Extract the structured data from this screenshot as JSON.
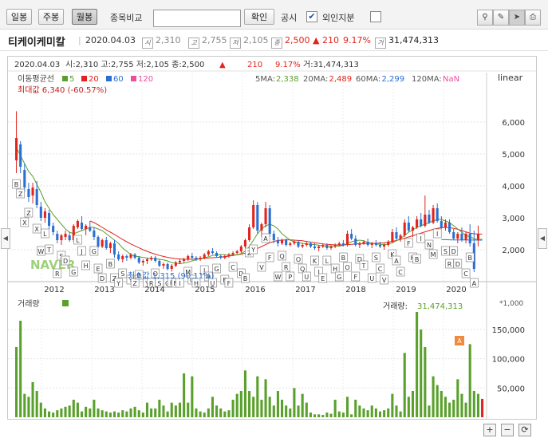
{
  "toolbar": {
    "daily": "일봉",
    "weekly": "주봉",
    "monthly": "월봉",
    "compare_label": "종목비교",
    "compare_value": "",
    "confirm": "확인",
    "disclosure": "공시",
    "disclosure_mark": "✔",
    "foreign": "외인지분"
  },
  "stock": {
    "name": "티케이케미칼",
    "date": "2020.04.03",
    "open_badge": "시",
    "open": "2,310",
    "high_badge": "고",
    "high": "2,755",
    "low_badge": "저",
    "low": "2,105",
    "close_badge": "종",
    "close": "2,500",
    "change": "▲ 210",
    "change_pct": "9.17%",
    "volume_badge": "거",
    "volume": "31,474,313"
  },
  "chart_header": {
    "line1_date": "2020.04.03",
    "line1_ohlc": "시:2,310  고:2,755  저:2,105  종:2,500",
    "line1_arrow": "▲",
    "line1_change": "210",
    "line1_pct": "9.17%",
    "line1_vol": "거:31,474,313",
    "ma_title": "이동평균선",
    "ma_legend": [
      {
        "label": "5",
        "color": "#5aa02c"
      },
      {
        "label": "20",
        "color": "#e1241c"
      },
      {
        "label": "60",
        "color": "#2a6fd1"
      },
      {
        "label": "120",
        "color": "#ec4fa0"
      }
    ],
    "max_label": "최대값 6,340 (-60.57%)",
    "ma_values": [
      {
        "label": "5MA:",
        "value": "2,338",
        "color": "#5aa02c"
      },
      {
        "label": "20MA:",
        "value": "2,489",
        "color": "#e1241c"
      },
      {
        "label": "60MA:",
        "value": "2,299",
        "color": "#2a6fd1"
      },
      {
        "label": "120MA:",
        "value": "NaN",
        "color": "#ec4fa0"
      }
    ],
    "scale_mode": "linear",
    "min_label": "최소값 1,315 (90.11%)",
    "vol_title": "거래량",
    "vol_value_label": "거래량:",
    "vol_value": "31,474,313",
    "vol_unit": "*1,000",
    "watermark": "NAVER"
  },
  "chart_data": [
    {
      "type": "candlestick",
      "ylim": [
        1000,
        6800
      ],
      "yticks": [
        2000,
        3000,
        4000,
        5000,
        6000
      ],
      "ytick_labels": [
        "2,000",
        "3,000",
        "4,000",
        "5,000",
        "6,000"
      ],
      "xticks": [
        "2012",
        "2013",
        "2014",
        "2015",
        "2016",
        "2017",
        "2018",
        "2019",
        "2020"
      ],
      "ohlc": [
        [
          4800,
          6340,
          4400,
          5500
        ],
        [
          5300,
          5400,
          4400,
          4600
        ],
        [
          4500,
          4700,
          3800,
          3950
        ],
        [
          3900,
          4100,
          3500,
          3650
        ],
        [
          3700,
          4100,
          3450,
          3950
        ],
        [
          3900,
          4150,
          3300,
          3400
        ],
        [
          3350,
          3500,
          2900,
          3000
        ],
        [
          3000,
          3300,
          2850,
          3200
        ],
        [
          3150,
          3250,
          2650,
          2750
        ],
        [
          2750,
          2850,
          2450,
          2550
        ],
        [
          2500,
          2600,
          2200,
          2300
        ],
        [
          2300,
          2500,
          2150,
          2450
        ],
        [
          2400,
          2600,
          2300,
          2500
        ],
        [
          2450,
          2550,
          2250,
          2300
        ],
        [
          2300,
          2800,
          2250,
          2750
        ],
        [
          2700,
          2950,
          2650,
          2900
        ],
        [
          2850,
          3050,
          2600,
          2650
        ],
        [
          2650,
          2800,
          2450,
          2750
        ],
        [
          2700,
          2900,
          2550,
          2600
        ],
        [
          2600,
          2700,
          2300,
          2400
        ],
        [
          2400,
          2450,
          2050,
          2100
        ],
        [
          2100,
          2350,
          2050,
          2300
        ],
        [
          2300,
          2400,
          2000,
          2050
        ],
        [
          2050,
          2250,
          1900,
          2200
        ],
        [
          2200,
          2300,
          1750,
          1850
        ],
        [
          1850,
          1950,
          1650,
          1700
        ],
        [
          1700,
          1850,
          1600,
          1800
        ],
        [
          1800,
          1850,
          1650,
          1750
        ],
        [
          1750,
          1900,
          1700,
          1850
        ],
        [
          1850,
          1900,
          1700,
          1750
        ],
        [
          1750,
          1800,
          1550,
          1600
        ],
        [
          1600,
          1700,
          1500,
          1650
        ],
        [
          1650,
          1750,
          1550,
          1700
        ],
        [
          1700,
          1800,
          1650,
          1750
        ],
        [
          1750,
          1800,
          1600,
          1650
        ],
        [
          1650,
          1700,
          1450,
          1500
        ],
        [
          1500,
          1600,
          1400,
          1550
        ],
        [
          1550,
          1600,
          1350,
          1400
        ],
        [
          1400,
          1550,
          1315,
          1500
        ],
        [
          1500,
          1650,
          1450,
          1600
        ],
        [
          1600,
          1700,
          1550,
          1650
        ],
        [
          1650,
          1750,
          1600,
          1700
        ],
        [
          1700,
          1850,
          1650,
          1800
        ],
        [
          1800,
          1900,
          1700,
          1750
        ],
        [
          1750,
          1800,
          1650,
          1700
        ],
        [
          1700,
          1800,
          1650,
          1750
        ],
        [
          1750,
          1900,
          1700,
          1850
        ],
        [
          1850,
          2000,
          1800,
          1950
        ],
        [
          1950,
          2050,
          1850,
          1900
        ],
        [
          1900,
          1950,
          1750,
          1800
        ],
        [
          1800,
          1850,
          1700,
          1750
        ],
        [
          1750,
          1850,
          1700,
          1800
        ],
        [
          1800,
          1900,
          1750,
          1850
        ],
        [
          1850,
          1950,
          1800,
          1900
        ],
        [
          1900,
          2000,
          1850,
          1950
        ],
        [
          1950,
          2150,
          1900,
          2100
        ],
        [
          2100,
          2350,
          2050,
          2300
        ],
        [
          2300,
          2800,
          2250,
          2700
        ],
        [
          2700,
          3550,
          2650,
          3400
        ],
        [
          3400,
          3500,
          2500,
          2600
        ],
        [
          2600,
          2850,
          2400,
          2800
        ],
        [
          2800,
          3500,
          2700,
          3300
        ],
        [
          3300,
          3400,
          2400,
          2500
        ],
        [
          2500,
          2600,
          2200,
          2300
        ],
        [
          2300,
          2400,
          2100,
          2200
        ],
        [
          2200,
          2350,
          2150,
          2300
        ],
        [
          2300,
          2350,
          2100,
          2150
        ],
        [
          2150,
          2250,
          2100,
          2200
        ],
        [
          2200,
          2300,
          2150,
          2250
        ],
        [
          2250,
          2300,
          2050,
          2100
        ],
        [
          2100,
          2200,
          2050,
          2150
        ],
        [
          2150,
          2250,
          2100,
          2200
        ],
        [
          2200,
          2250,
          2050,
          2100
        ],
        [
          2100,
          2200,
          2000,
          2050
        ],
        [
          2050,
          2150,
          1950,
          2100
        ],
        [
          2100,
          2200,
          2050,
          2150
        ],
        [
          2150,
          2200,
          2000,
          2050
        ],
        [
          2050,
          2150,
          2000,
          2100
        ],
        [
          2100,
          2200,
          2050,
          2150
        ],
        [
          2150,
          2250,
          2100,
          2200
        ],
        [
          2200,
          2300,
          2100,
          2150
        ],
        [
          2150,
          2600,
          2100,
          2500
        ],
        [
          2500,
          2650,
          2300,
          2350
        ],
        [
          2350,
          2450,
          2100,
          2150
        ],
        [
          2150,
          2250,
          2050,
          2200
        ],
        [
          2200,
          2300,
          2150,
          2250
        ],
        [
          2250,
          2350,
          2100,
          2150
        ],
        [
          2150,
          2250,
          2050,
          2200
        ],
        [
          2200,
          2300,
          2100,
          2150
        ],
        [
          2150,
          2250,
          2050,
          2100
        ],
        [
          2100,
          2200,
          2000,
          2150
        ],
        [
          2150,
          2300,
          2100,
          2250
        ],
        [
          2250,
          2650,
          2200,
          2550
        ],
        [
          2550,
          2700,
          2300,
          2350
        ],
        [
          2350,
          2500,
          2250,
          2450
        ],
        [
          2450,
          2950,
          2400,
          2850
        ],
        [
          2850,
          3050,
          2550,
          2600
        ],
        [
          2600,
          2750,
          2400,
          2700
        ],
        [
          2700,
          3050,
          2650,
          2950
        ],
        [
          2950,
          3150,
          2700,
          2750
        ],
        [
          2750,
          3700,
          2700,
          3100
        ],
        [
          3100,
          3250,
          2800,
          2850
        ],
        [
          2850,
          3400,
          2800,
          3300
        ],
        [
          3300,
          3450,
          2850,
          2900
        ],
        [
          2900,
          3050,
          2650,
          2700
        ],
        [
          2700,
          2950,
          2600,
          2850
        ],
        [
          2850,
          2950,
          2500,
          2550
        ],
        [
          2550,
          2650,
          2300,
          2350
        ],
        [
          2350,
          2550,
          2200,
          2500
        ],
        [
          2500,
          2700,
          2250,
          2300
        ],
        [
          2300,
          2550,
          2200,
          2500
        ],
        [
          2500,
          2800,
          2100,
          2200
        ],
        [
          2200,
          2600,
          1300,
          1400
        ],
        [
          2310,
          2755,
          2105,
          2500
        ]
      ],
      "ma5": [
        5200,
        4950,
        4700,
        4450,
        4300,
        4050,
        3800,
        3500,
        3300,
        3100,
        2950,
        2800,
        2650,
        2550,
        2500,
        2550,
        2600,
        2650,
        2700,
        2700,
        2650,
        2600,
        2500,
        2400,
        2300,
        2200,
        2050,
        1950,
        1850,
        1800,
        1780,
        1760,
        1740,
        1720,
        1720,
        1700,
        1680,
        1650,
        1600,
        1580,
        1560,
        1580,
        1610,
        1650,
        1690,
        1720,
        1750,
        1780,
        1820,
        1840,
        1850,
        1840,
        1830,
        1830,
        1840,
        1880,
        1950,
        2100,
        2300,
        2500,
        2650,
        2750,
        2800,
        2750,
        2650,
        2500,
        2400,
        2300,
        2250,
        2220,
        2200,
        2180,
        2170,
        2160,
        2140,
        2120,
        2110,
        2100,
        2110,
        2120,
        2130,
        2200,
        2250,
        2280,
        2300,
        2280,
        2230,
        2200,
        2180,
        2170,
        2160,
        2170,
        2220,
        2280,
        2350,
        2450,
        2550,
        2620,
        2700,
        2750,
        2800,
        2850,
        2900,
        2950,
        2950,
        2900,
        2850,
        2750,
        2650,
        2550,
        2450,
        2400,
        2350,
        2300,
        2338
      ],
      "ma20": [
        null,
        null,
        null,
        null,
        null,
        null,
        null,
        null,
        null,
        null,
        null,
        null,
        null,
        null,
        null,
        null,
        null,
        null,
        2900,
        2850,
        2780,
        2700,
        2620,
        2550,
        2480,
        2400,
        2320,
        2250,
        2180,
        2120,
        2060,
        2000,
        1950,
        1900,
        1860,
        1820,
        1790,
        1760,
        1740,
        1720,
        1710,
        1700,
        1700,
        1700,
        1710,
        1720,
        1730,
        1740,
        1750,
        1760,
        1770,
        1780,
        1800,
        1820,
        1840,
        1860,
        1890,
        1930,
        1980,
        2040,
        2100,
        2160,
        2220,
        2260,
        2290,
        2300,
        2310,
        2310,
        2300,
        2290,
        2280,
        2260,
        2240,
        2220,
        2200,
        2180,
        2170,
        2160,
        2150,
        2150,
        2150,
        2160,
        2170,
        2180,
        2190,
        2190,
        2200,
        2200,
        2200,
        2210,
        2220,
        2240,
        2260,
        2290,
        2320,
        2360,
        2400,
        2440,
        2480,
        2520,
        2560,
        2600,
        2640,
        2670,
        2690,
        2700,
        2690,
        2670,
        2640,
        2600,
        2560,
        2520,
        2500,
        2490,
        2489
      ],
      "ma60": [
        null,
        null,
        null,
        null,
        null,
        null,
        null,
        null,
        null,
        null,
        null,
        null,
        null,
        null,
        null,
        null,
        null,
        null,
        null,
        null,
        null,
        null,
        null,
        null,
        null,
        null,
        null,
        null,
        null,
        null,
        null,
        null,
        null,
        null,
        null,
        null,
        null,
        null,
        null,
        null,
        null,
        null,
        null,
        null,
        null,
        null,
        null,
        null,
        null,
        null,
        null,
        null,
        null,
        null,
        null,
        null,
        null,
        null,
        null,
        null,
        null,
        null,
        null,
        null,
        null,
        null,
        null,
        null,
        null,
        null,
        null,
        null,
        null,
        null,
        null,
        null,
        null,
        null,
        null,
        null,
        null,
        null,
        null,
        null,
        null,
        null,
        null,
        null,
        null,
        null,
        null,
        null,
        null,
        null,
        null,
        null,
        null,
        null,
        null,
        null,
        null,
        null,
        null,
        null,
        2320,
        2315,
        2310,
        2308,
        2306,
        2305,
        2304,
        2303,
        2302,
        2300,
        2299
      ]
    },
    {
      "type": "bar",
      "series": [
        {
          "name": "거래량",
          "unit": "*1,000"
        }
      ],
      "ylim": [
        0,
        180000
      ],
      "yticks": [
        50000,
        100000,
        150000
      ],
      "ytick_labels": [
        "50,000",
        "100,000",
        "150,000"
      ],
      "values": [
        120000,
        165000,
        40000,
        35000,
        60000,
        45000,
        25000,
        15000,
        10000,
        8000,
        12000,
        15000,
        18000,
        20000,
        30000,
        25000,
        10000,
        18000,
        15000,
        30000,
        15000,
        12000,
        10000,
        8000,
        10000,
        8000,
        12000,
        10000,
        15000,
        18000,
        12000,
        8000,
        25000,
        15000,
        15000,
        30000,
        20000,
        10000,
        25000,
        20000,
        25000,
        75000,
        25000,
        70000,
        15000,
        10000,
        8000,
        15000,
        35000,
        20000,
        15000,
        10000,
        12000,
        30000,
        40000,
        45000,
        80000,
        45000,
        35000,
        70000,
        30000,
        65000,
        35000,
        20000,
        45000,
        30000,
        20000,
        15000,
        50000,
        20000,
        40000,
        25000,
        8000,
        5000,
        5000,
        4000,
        8000,
        6000,
        30000,
        10000,
        8000,
        35000,
        5000,
        30000,
        20000,
        15000,
        12000,
        20000,
        15000,
        10000,
        12000,
        15000,
        40000,
        20000,
        10000,
        110000,
        35000,
        45000,
        180000,
        150000,
        120000,
        20000,
        70000,
        55000,
        45000,
        35000,
        25000,
        30000,
        65000,
        40000,
        25000,
        125000,
        45000,
        40000,
        31474
      ]
    }
  ],
  "markers": {
    "letters": [
      "B",
      "Z",
      "X",
      "Z",
      "X",
      "W",
      "L",
      "T",
      "R",
      "S",
      "D",
      "G",
      "L",
      "J",
      "H",
      "G",
      "E",
      "D",
      "B",
      "Z",
      "Y",
      "S",
      "Y",
      "Z",
      "B",
      "Y",
      "R",
      "O",
      "S",
      "O",
      "P",
      "N",
      "I",
      "M",
      "U",
      "H",
      "J",
      "R",
      "U",
      "G",
      "E",
      "F",
      "C",
      "D",
      "B",
      "Z",
      "Y",
      "V",
      "A",
      "F",
      "W",
      "Q",
      "R",
      "P",
      "O",
      "Q",
      "U",
      "K",
      "I",
      "E",
      "L",
      "H",
      "G",
      "B",
      "O",
      "F",
      "D",
      "T",
      "U",
      "S",
      "C",
      "V",
      "K",
      "A",
      "C",
      "F",
      "H",
      "B",
      "I",
      "N",
      "M",
      "I",
      "S",
      "R",
      "D",
      "D",
      "C",
      "B",
      "A"
    ],
    "left_marker": "A"
  },
  "controls": {
    "zoom_in": "+",
    "zoom_out": "−",
    "reset": "⟳"
  }
}
